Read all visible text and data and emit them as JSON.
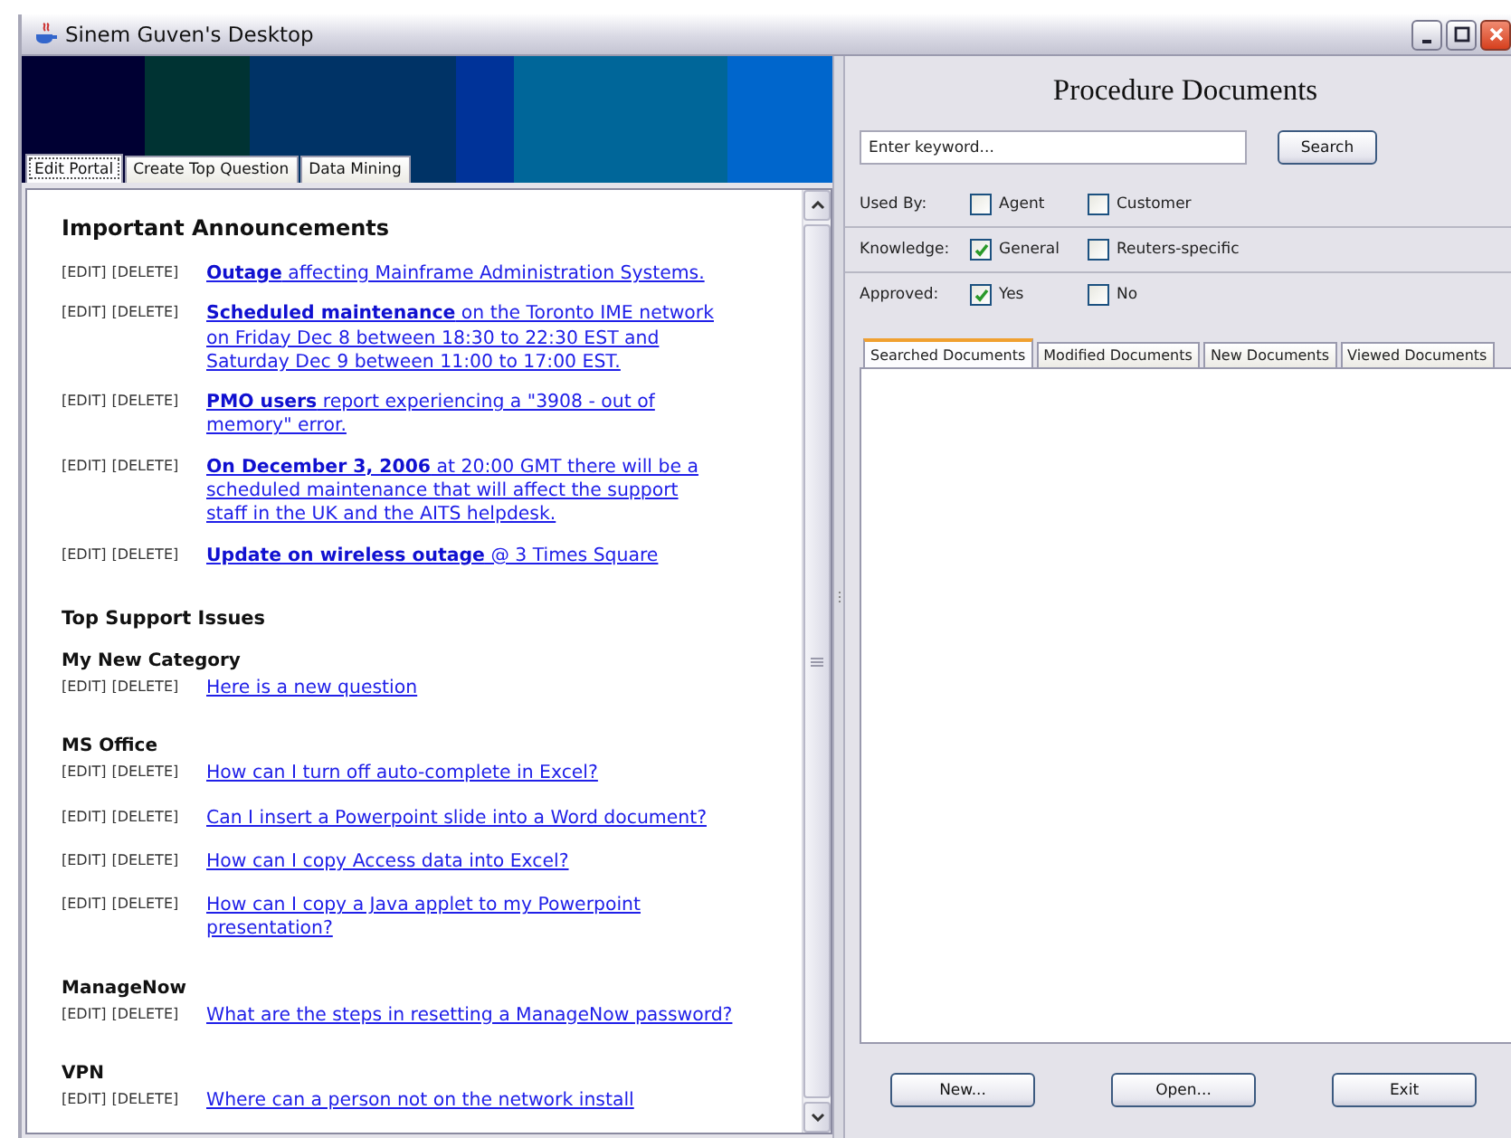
{
  "window": {
    "title": "Sinem Guven's Desktop"
  },
  "portal": {
    "tabs": [
      {
        "label": "Edit Portal",
        "selected": true
      },
      {
        "label": "Create Top Question",
        "selected": false
      },
      {
        "label": "Data Mining",
        "selected": false
      }
    ],
    "announcements": {
      "heading": "Important Announcements",
      "items": [
        {
          "edit": "[EDIT]",
          "delete": "[DELETE]",
          "text": "**Outage** affecting Mainframe Administration Systems."
        },
        {
          "edit": "[EDIT]",
          "delete": "[DELETE]",
          "text": "**Scheduled maintenance** on the Toronto IME network on Friday Dec 8 between 18:30 to 22:30 EST and Saturday Dec 9 between 11:00 to 17:00 EST."
        },
        {
          "edit": "[EDIT]",
          "delete": "[DELETE]",
          "text": "**PMO users** report experiencing a \"3908 - out of memory\" error."
        },
        {
          "edit": "[EDIT]",
          "delete": "[DELETE]",
          "text": "**On December 3, 2006** at 20:00 GMT there will be a scheduled maintenance that will affect the support staff in the UK and the AITS helpdesk."
        },
        {
          "edit": "[EDIT]",
          "delete": "[DELETE]",
          "text": "**Update on wireless outage** @ 3 Times Square"
        }
      ]
    },
    "support": {
      "heading": "Top Support Issues",
      "categories": [
        {
          "name": "My New Category",
          "items": [
            {
              "edit": "[EDIT]",
              "delete": "[DELETE]",
              "text": "Here is a new question"
            }
          ]
        },
        {
          "name": "MS Office",
          "items": [
            {
              "edit": "[EDIT]",
              "delete": "[DELETE]",
              "text": "How can I turn off auto-complete in Excel?"
            },
            {
              "edit": "[EDIT]",
              "delete": "[DELETE]",
              "text": "Can I insert a Powerpoint slide into a Word document?"
            },
            {
              "edit": "[EDIT]",
              "delete": "[DELETE]",
              "text": "How can I copy Access data into Excel?"
            },
            {
              "edit": "[EDIT]",
              "delete": "[DELETE]",
              "text": "How can I copy a Java applet to my Powerpoint presentation?"
            }
          ]
        },
        {
          "name": "ManageNow",
          "items": [
            {
              "edit": "[EDIT]",
              "delete": "[DELETE]",
              "text": "What are the steps in resetting a ManageNow password?"
            }
          ]
        },
        {
          "name": "VPN",
          "items": [
            {
              "edit": "[EDIT]",
              "delete": "[DELETE]",
              "text": "Where can a person not on the network install"
            }
          ]
        }
      ]
    }
  },
  "documents": {
    "title": "Procedure Documents",
    "search": {
      "placeholder": "Enter keyword...",
      "button": "Search"
    },
    "filters": [
      {
        "label": "Used By:",
        "options": [
          {
            "label": "Agent",
            "checked": false
          },
          {
            "label": "Customer",
            "checked": false
          }
        ]
      },
      {
        "label": "Knowledge:",
        "options": [
          {
            "label": "General",
            "checked": true
          },
          {
            "label": "Reuters-specific",
            "checked": false
          }
        ]
      },
      {
        "label": "Approved:",
        "options": [
          {
            "label": "Yes",
            "checked": true
          },
          {
            "label": "No",
            "checked": false
          }
        ]
      }
    ],
    "tabs": [
      {
        "label": "Searched Documents",
        "selected": true
      },
      {
        "label": "Modified Documents",
        "selected": false
      },
      {
        "label": "New Documents",
        "selected": false
      },
      {
        "label": "Viewed Documents",
        "selected": false
      }
    ],
    "buttons": [
      "New...",
      "Open...",
      "Exit"
    ]
  }
}
